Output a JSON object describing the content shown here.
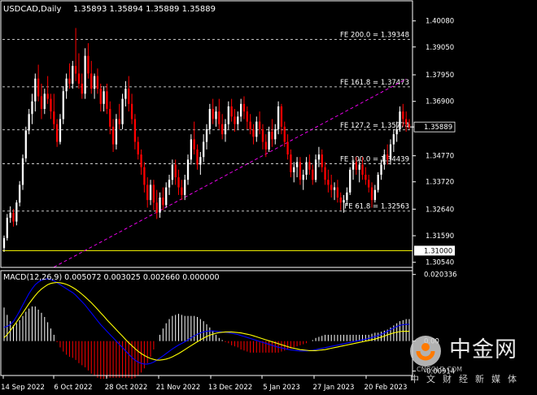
{
  "header": {
    "symbol": "USDCAD,Daily",
    "ohlc": "1.35893 1.35894 1.35889 1.35889"
  },
  "macd_label": "MACD(12,26,9) 0.005072 0.003025 0.002660 0.000000",
  "watermark": {
    "brand": "中金网",
    "subtitle": "中文财经新媒体",
    "site": "CNGOLD.COM"
  },
  "colors": {
    "background": "#000000",
    "axis": "#ffffff",
    "candle_up": "#ffffff",
    "candle_down": "#ff0000",
    "fib_line": "#ffffff",
    "trend_line": "#ff00ff",
    "support_line": "#ffff00",
    "macd_line": "#0000ff",
    "signal_line": "#ffff00",
    "hist_up": "#ffffff",
    "hist_down": "#ff0000"
  },
  "chart_data": [
    {
      "type": "candlestick",
      "ylim": [
        1.3037,
        1.4081
      ],
      "y_ticks": [
        1.4008,
        1.3905,
        1.3795,
        1.369,
        1.3475,
        1.3372,
        1.3264,
        1.3159,
        1.3054
      ],
      "y_tick_labels": [
        "1.40080",
        "1.39050",
        "1.37950",
        "1.36900",
        "1.34770",
        "1.33720",
        "1.32640",
        "1.31590",
        "1.30540"
      ],
      "x_labels": [
        "14 Sep 2022",
        "6 Oct 2022",
        "28 Oct 2022",
        "21 Nov 2022",
        "13 Dec 2022",
        "5 Jan 2023",
        "27 Jan 2023",
        "20 Feb 2023"
      ],
      "current_price": 1.35889,
      "current_price_label": "1.35889",
      "fib_levels": [
        {
          "label": "FE 200.0 = 1.39348",
          "value": 1.39348
        },
        {
          "label": "FE 161.8 = 1.37473",
          "value": 1.37473
        },
        {
          "label": "FE 127.2 = 1.35774",
          "value": 1.35774
        },
        {
          "label": "FE 100.0 = 1.34439",
          "value": 1.34439
        },
        {
          "label": "FE 61.8 = 1.32563",
          "value": 1.32563
        }
      ],
      "support": {
        "value": 1.31,
        "label": "1.31000"
      },
      "trendline": [
        {
          "bar": 16,
          "price": 1.3035
        },
        {
          "bar": 129,
          "price": 1.3778
        }
      ],
      "candles": [
        [
          1.311,
          1.316,
          1.3095,
          1.315
        ],
        [
          1.315,
          1.3245,
          1.314,
          1.323
        ],
        [
          1.323,
          1.3275,
          1.321,
          1.325
        ],
        [
          1.325,
          1.3265,
          1.3195,
          1.3215
        ],
        [
          1.3215,
          1.33,
          1.32,
          1.329
        ],
        [
          1.329,
          1.3375,
          1.3275,
          1.336
        ],
        [
          1.336,
          1.348,
          1.334,
          1.3465
        ],
        [
          1.3465,
          1.359,
          1.345,
          1.3575
        ],
        [
          1.3575,
          1.366,
          1.356,
          1.364
        ],
        [
          1.364,
          1.372,
          1.36,
          1.369
        ],
        [
          1.369,
          1.38,
          1.365,
          1.378
        ],
        [
          1.378,
          1.3835,
          1.369,
          1.371
        ],
        [
          1.371,
          1.376,
          1.362,
          1.366
        ],
        [
          1.366,
          1.374,
          1.364,
          1.372
        ],
        [
          1.372,
          1.379,
          1.368,
          1.37
        ],
        [
          1.37,
          1.372,
          1.362,
          1.365
        ],
        [
          1.365,
          1.372,
          1.358,
          1.36
        ],
        [
          1.36,
          1.362,
          1.351,
          1.353
        ],
        [
          1.353,
          1.364,
          1.352,
          1.362
        ],
        [
          1.362,
          1.375,
          1.36,
          1.373
        ],
        [
          1.373,
          1.38,
          1.37,
          1.378
        ],
        [
          1.378,
          1.384,
          1.374,
          1.376
        ],
        [
          1.376,
          1.385,
          1.374,
          1.383
        ],
        [
          1.383,
          1.398,
          1.377,
          1.38
        ],
        [
          1.38,
          1.388,
          1.374,
          1.376
        ],
        [
          1.376,
          1.38,
          1.37,
          1.372
        ],
        [
          1.372,
          1.39,
          1.37,
          1.387
        ],
        [
          1.387,
          1.392,
          1.378,
          1.38
        ],
        [
          1.38,
          1.385,
          1.372,
          1.374
        ],
        [
          1.374,
          1.38,
          1.37,
          1.379
        ],
        [
          1.379,
          1.382,
          1.372,
          1.374
        ],
        [
          1.374,
          1.376,
          1.365,
          1.368
        ],
        [
          1.368,
          1.375,
          1.365,
          1.373
        ],
        [
          1.373,
          1.376,
          1.364,
          1.366
        ],
        [
          1.366,
          1.369,
          1.356,
          1.359
        ],
        [
          1.359,
          1.362,
          1.349,
          1.352
        ],
        [
          1.352,
          1.364,
          1.35,
          1.362
        ],
        [
          1.362,
          1.368,
          1.358,
          1.36
        ],
        [
          1.36,
          1.372,
          1.358,
          1.37
        ],
        [
          1.37,
          1.377,
          1.367,
          1.374
        ],
        [
          1.374,
          1.379,
          1.365,
          1.368
        ],
        [
          1.368,
          1.372,
          1.36,
          1.362
        ],
        [
          1.362,
          1.364,
          1.35,
          1.353
        ],
        [
          1.353,
          1.355,
          1.346,
          1.348
        ],
        [
          1.348,
          1.35,
          1.34,
          1.343
        ],
        [
          1.343,
          1.345,
          1.333,
          1.336
        ],
        [
          1.336,
          1.339,
          1.327,
          1.33
        ],
        [
          1.33,
          1.338,
          1.328,
          1.336
        ],
        [
          1.336,
          1.338,
          1.326,
          1.329
        ],
        [
          1.329,
          1.334,
          1.3225,
          1.325
        ],
        [
          1.325,
          1.333,
          1.323,
          1.331
        ],
        [
          1.331,
          1.335,
          1.326,
          1.328
        ],
        [
          1.328,
          1.337,
          1.327,
          1.335
        ],
        [
          1.335,
          1.34,
          1.332,
          1.338
        ],
        [
          1.338,
          1.346,
          1.336,
          1.344
        ],
        [
          1.344,
          1.346,
          1.336,
          1.339
        ],
        [
          1.339,
          1.342,
          1.332,
          1.335
        ],
        [
          1.335,
          1.338,
          1.33,
          1.332
        ],
        [
          1.332,
          1.34,
          1.33,
          1.338
        ],
        [
          1.338,
          1.348,
          1.336,
          1.346
        ],
        [
          1.346,
          1.356,
          1.344,
          1.354
        ],
        [
          1.354,
          1.361,
          1.348,
          1.35
        ],
        [
          1.35,
          1.352,
          1.342,
          1.344
        ],
        [
          1.344,
          1.349,
          1.34,
          1.347
        ],
        [
          1.347,
          1.356,
          1.345,
          1.353
        ],
        [
          1.353,
          1.36,
          1.35,
          1.358
        ],
        [
          1.358,
          1.368,
          1.356,
          1.366
        ],
        [
          1.366,
          1.37,
          1.36,
          1.362
        ],
        [
          1.362,
          1.367,
          1.359,
          1.365
        ],
        [
          1.365,
          1.37,
          1.358,
          1.36
        ],
        [
          1.36,
          1.364,
          1.354,
          1.356
        ],
        [
          1.356,
          1.362,
          1.353,
          1.36
        ],
        [
          1.36,
          1.369,
          1.358,
          1.367
        ],
        [
          1.367,
          1.37,
          1.361,
          1.363
        ],
        [
          1.363,
          1.366,
          1.357,
          1.36
        ],
        [
          1.36,
          1.365,
          1.358,
          1.363
        ],
        [
          1.363,
          1.37,
          1.361,
          1.368
        ],
        [
          1.368,
          1.371,
          1.362,
          1.365
        ],
        [
          1.365,
          1.367,
          1.358,
          1.361
        ],
        [
          1.361,
          1.364,
          1.356,
          1.358
        ],
        [
          1.358,
          1.36,
          1.352,
          1.355
        ],
        [
          1.355,
          1.363,
          1.353,
          1.361
        ],
        [
          1.361,
          1.365,
          1.356,
          1.358
        ],
        [
          1.358,
          1.36,
          1.35,
          1.353
        ],
        [
          1.353,
          1.356,
          1.347,
          1.35
        ],
        [
          1.35,
          1.359,
          1.349,
          1.357
        ],
        [
          1.357,
          1.362,
          1.351,
          1.354
        ],
        [
          1.354,
          1.36,
          1.352,
          1.358
        ],
        [
          1.358,
          1.369,
          1.356,
          1.367
        ],
        [
          1.367,
          1.368,
          1.356,
          1.359
        ],
        [
          1.359,
          1.361,
          1.351,
          1.353
        ],
        [
          1.353,
          1.356,
          1.346,
          1.348
        ],
        [
          1.348,
          1.35,
          1.339,
          1.341
        ],
        [
          1.341,
          1.345,
          1.337,
          1.343
        ],
        [
          1.343,
          1.347,
          1.339,
          1.345
        ],
        [
          1.345,
          1.347,
          1.336,
          1.338
        ],
        [
          1.338,
          1.342,
          1.334,
          1.34
        ],
        [
          1.34,
          1.347,
          1.338,
          1.345
        ],
        [
          1.345,
          1.348,
          1.34,
          1.342
        ],
        [
          1.342,
          1.344,
          1.336,
          1.338
        ],
        [
          1.338,
          1.348,
          1.337,
          1.346
        ],
        [
          1.346,
          1.351,
          1.343,
          1.348
        ],
        [
          1.348,
          1.35,
          1.341,
          1.343
        ],
        [
          1.343,
          1.345,
          1.336,
          1.338
        ],
        [
          1.338,
          1.342,
          1.333,
          1.336
        ],
        [
          1.336,
          1.34,
          1.331,
          1.334
        ],
        [
          1.334,
          1.337,
          1.33,
          1.335
        ],
        [
          1.335,
          1.338,
          1.329,
          1.331
        ],
        [
          1.331,
          1.333,
          1.326,
          1.329
        ],
        [
          1.329,
          1.332,
          1.325,
          1.33
        ],
        [
          1.33,
          1.335,
          1.328,
          1.333
        ],
        [
          1.333,
          1.343,
          1.332,
          1.342
        ],
        [
          1.342,
          1.346,
          1.338,
          1.345
        ],
        [
          1.345,
          1.347,
          1.34,
          1.342
        ],
        [
          1.342,
          1.346,
          1.337,
          1.344
        ],
        [
          1.344,
          1.347,
          1.338,
          1.34
        ],
        [
          1.34,
          1.343,
          1.336,
          1.338
        ],
        [
          1.338,
          1.34,
          1.333,
          1.335
        ],
        [
          1.335,
          1.337,
          1.327,
          1.33
        ],
        [
          1.33,
          1.336,
          1.329,
          1.334
        ],
        [
          1.334,
          1.341,
          1.333,
          1.34
        ],
        [
          1.34,
          1.346,
          1.338,
          1.344
        ],
        [
          1.344,
          1.35,
          1.342,
          1.348
        ],
        [
          1.348,
          1.352,
          1.344,
          1.346
        ],
        [
          1.346,
          1.354,
          1.344,
          1.352
        ],
        [
          1.352,
          1.358,
          1.349,
          1.356
        ],
        [
          1.356,
          1.361,
          1.353,
          1.358
        ],
        [
          1.358,
          1.367,
          1.357,
          1.365
        ],
        [
          1.365,
          1.368,
          1.359,
          1.362
        ],
        [
          1.362,
          1.365,
          1.357,
          1.36
        ],
        [
          1.36,
          1.362,
          1.358,
          1.35889
        ]
      ]
    },
    {
      "type": "macd",
      "title": "MACD(12,26,9)",
      "values": {
        "main": 0.005072,
        "signal": 0.003025,
        "histogram": 0.00266,
        "other": 0.0
      },
      "ylim": [
        -0.0105,
        0.0215
      ],
      "y_ticks": [
        0.020336,
        0.0,
        -0.00914
      ],
      "y_tick_labels": [
        "0.020336",
        "0.00",
        "-0.00914"
      ],
      "macd": [
        0.0042,
        0.0045,
        0.0051,
        0.006,
        0.0075,
        0.0092,
        0.011,
        0.0128,
        0.0145,
        0.016,
        0.0172,
        0.018,
        0.0186,
        0.0189,
        0.019,
        0.0188,
        0.0184,
        0.0178,
        0.0172,
        0.0166,
        0.016,
        0.0154,
        0.0148,
        0.014,
        0.013,
        0.012,
        0.011,
        0.0098,
        0.0086,
        0.0074,
        0.0062,
        0.005,
        0.004,
        0.003,
        0.002,
        0.001,
        0.0,
        -0.001,
        -0.002,
        -0.003,
        -0.004,
        -0.005,
        -0.0058,
        -0.0064,
        -0.0068,
        -0.007,
        -0.007,
        -0.0068,
        -0.0064,
        -0.0058,
        -0.0052,
        -0.0045,
        -0.0038,
        -0.0031,
        -0.0024,
        -0.0018,
        -0.0012,
        -0.0007,
        -0.0002,
        0.0004,
        0.001,
        0.0016,
        0.0021,
        0.0025,
        0.0028,
        0.003,
        0.0031,
        0.0031,
        0.003,
        0.0029,
        0.0028,
        0.0027,
        0.0026,
        0.0024,
        0.0022,
        0.002,
        0.0017,
        0.0014,
        0.0011,
        0.0008,
        0.0005,
        0.0002,
        -0.0001,
        -0.0004,
        -0.0007,
        -0.001,
        -0.0013,
        -0.0016,
        -0.0019,
        -0.0021,
        -0.0023,
        -0.0025,
        -0.0027,
        -0.0028,
        -0.0029,
        -0.003,
        -0.003,
        -0.003,
        -0.0029,
        -0.0028,
        -0.0026,
        -0.0024,
        -0.0022,
        -0.002,
        -0.0018,
        -0.0016,
        -0.0014,
        -0.0012,
        -0.001,
        -0.0008,
        -0.0006,
        -0.0004,
        -0.0002,
        0.0,
        0.0002,
        0.0004,
        0.0006,
        0.0008,
        0.0011,
        0.0014,
        0.0017,
        0.0021,
        0.0025,
        0.003,
        0.0035,
        0.004,
        0.0044,
        0.0048,
        0.005,
        0.0051,
        0.0051
      ],
      "signal": [
        0.001,
        0.002,
        0.0032,
        0.0045,
        0.0058,
        0.0072,
        0.0086,
        0.01,
        0.0114,
        0.0127,
        0.0139,
        0.015,
        0.0159,
        0.0166,
        0.0172,
        0.0176,
        0.0178,
        0.0179,
        0.0178,
        0.0176,
        0.0173,
        0.0169,
        0.0164,
        0.0158,
        0.0151,
        0.0143,
        0.0135,
        0.0126,
        0.0117,
        0.0107,
        0.0097,
        0.0086,
        0.0076,
        0.0065,
        0.0055,
        0.0045,
        0.0035,
        0.0025,
        0.0015,
        0.0005,
        -0.0005,
        -0.0014,
        -0.0023,
        -0.0031,
        -0.0038,
        -0.0044,
        -0.0049,
        -0.0053,
        -0.0056,
        -0.0058,
        -0.0058,
        -0.0057,
        -0.0055,
        -0.0052,
        -0.0048,
        -0.0043,
        -0.0038,
        -0.0032,
        -0.0026,
        -0.002,
        -0.0014,
        -0.0008,
        -0.0002,
        0.0004,
        0.0009,
        0.0014,
        0.0018,
        0.0021,
        0.0024,
        0.0026,
        0.0027,
        0.0028,
        0.0028,
        0.0028,
        0.0027,
        0.0026,
        0.0025,
        0.0023,
        0.0021,
        0.0019,
        0.0016,
        0.0013,
        0.001,
        0.0007,
        0.0004,
        0.0001,
        -0.0002,
        -0.0005,
        -0.0008,
        -0.0011,
        -0.0014,
        -0.0017,
        -0.002,
        -0.0022,
        -0.0024,
        -0.0026,
        -0.0027,
        -0.0028,
        -0.0029,
        -0.0029,
        -0.0029,
        -0.0028,
        -0.0027,
        -0.0026,
        -0.0024,
        -0.0022,
        -0.002,
        -0.0018,
        -0.0016,
        -0.0014,
        -0.0012,
        -0.001,
        -0.0008,
        -0.0006,
        -0.0004,
        -0.0002,
        0.0,
        0.0002,
        0.0004,
        0.0006,
        0.0009,
        0.0012,
        0.0015,
        0.0019,
        0.0022,
        0.0025,
        0.0027,
        0.0029,
        0.003,
        0.003,
        0.003
      ]
    }
  ]
}
